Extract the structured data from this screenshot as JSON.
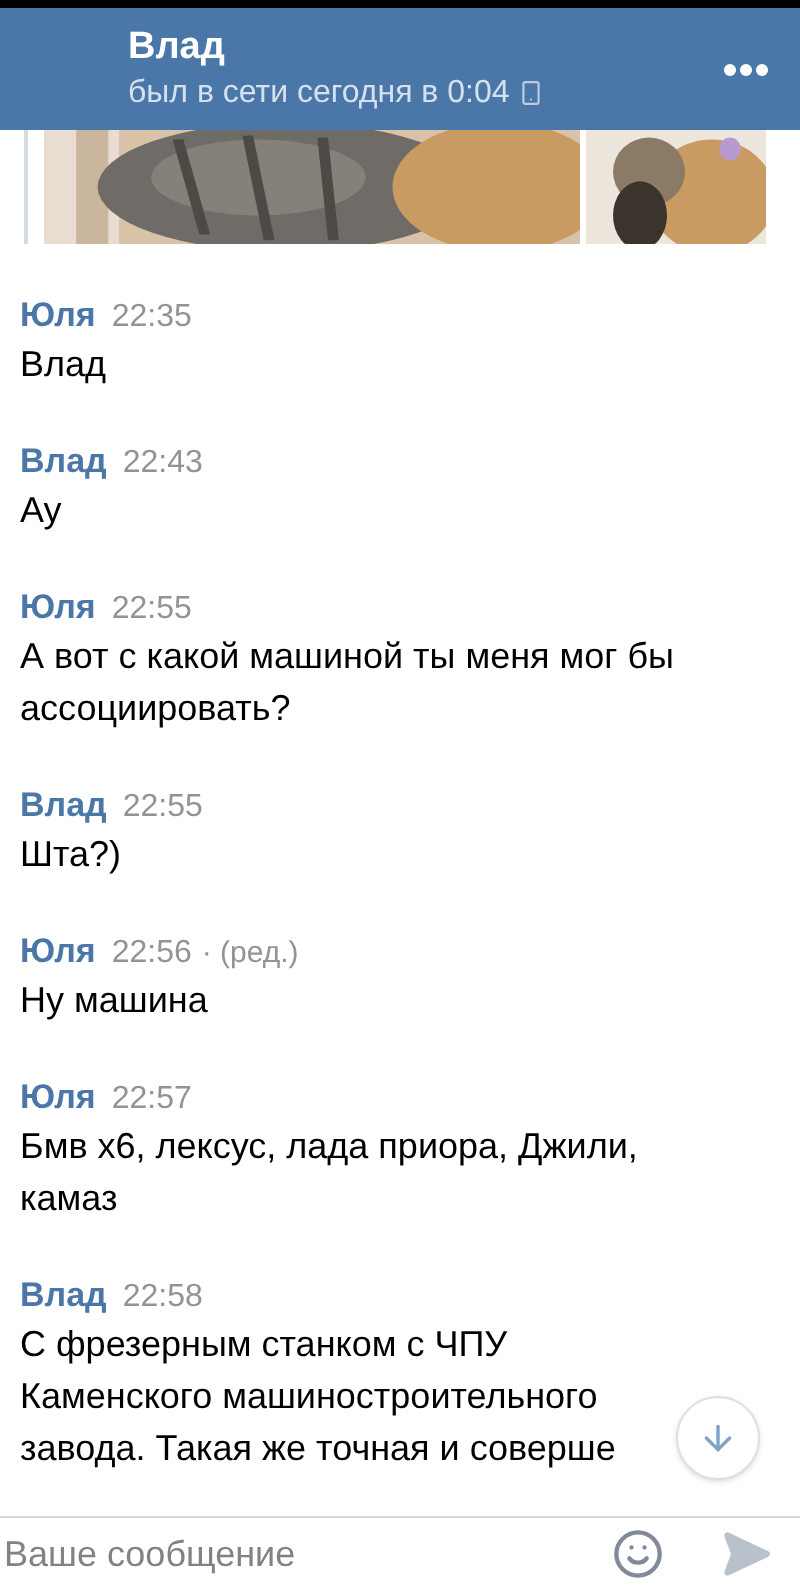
{
  "header": {
    "title": "Влад",
    "status": "был в сети сегодня в 0:04"
  },
  "messages": [
    {
      "author": "Юля",
      "time": "22:35",
      "text": "Влад"
    },
    {
      "author": "Влад",
      "time": "22:43",
      "text": "Ау"
    },
    {
      "author": "Юля",
      "time": "22:55",
      "text": "А вот с какой машиной ты меня мог бы ассоциировать?"
    },
    {
      "author": "Влад",
      "time": "22:55",
      "text": "Шта?)"
    },
    {
      "author": "Юля",
      "time": "22:56",
      "edited": "· (ред.)",
      "text": "Ну машина"
    },
    {
      "author": "Юля",
      "time": "22:57",
      "text": "Бмв х6, лексус, лада приора, Джили, камаз"
    },
    {
      "author": "Влад",
      "time": "22:58",
      "text": "С фрезерным станком с ЧПУ Каменского машиностроительного завода. Такая же точная и соверше"
    }
  ],
  "composer": {
    "placeholder": "Ваше сообщение"
  }
}
